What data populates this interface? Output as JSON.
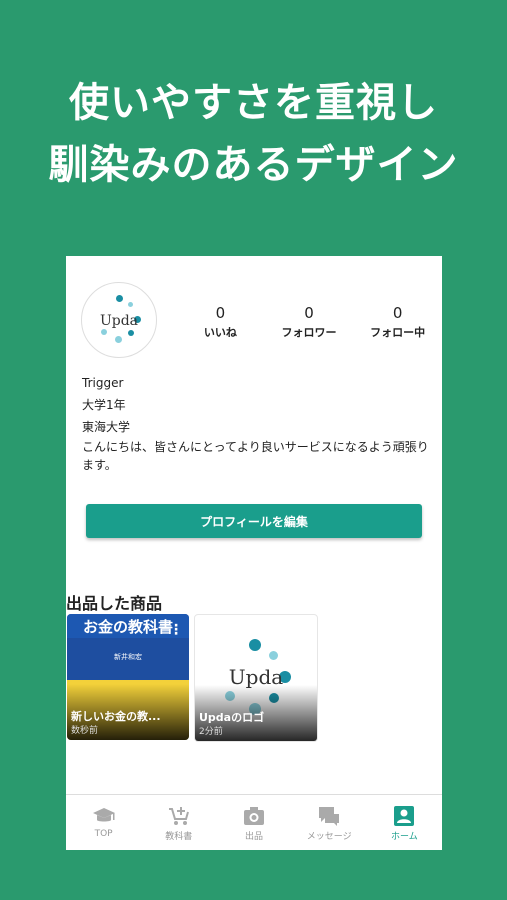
{
  "headline": {
    "line1": "使いやすさを重視し",
    "line2": "馴染みのあるデザイン"
  },
  "profile": {
    "avatar_logo_text": "Upda",
    "stats": [
      {
        "value": "0",
        "label": "いいね"
      },
      {
        "value": "0",
        "label": "フォロワー"
      },
      {
        "value": "0",
        "label": "フォロー中"
      }
    ],
    "name": "Trigger",
    "grade": "大学1年",
    "university": "東海大学",
    "bio": "こんにちは、皆さんにとってより良いサービスになるよう頑張ります。",
    "edit_button_label": "プロフィールを編集"
  },
  "listings": {
    "section_title": "出品した商品",
    "items": [
      {
        "name": "新しいお金の教...",
        "time": "数秒前",
        "cover_title": "お金の教科書",
        "cover_author": "新井和宏"
      },
      {
        "name": "Updaのロゴ",
        "time": "2分前",
        "cover_logo_text": "Upda"
      }
    ]
  },
  "tabbar": {
    "tabs": [
      {
        "label": "TOP",
        "icon": "graduation-cap-icon"
      },
      {
        "label": "教科書",
        "icon": "cart-add-icon"
      },
      {
        "label": "出品",
        "icon": "camera-icon"
      },
      {
        "label": "メッセージ",
        "icon": "chat-icon"
      },
      {
        "label": "ホーム",
        "icon": "user-profile-icon",
        "active": true
      }
    ]
  },
  "colors": {
    "background": "#2a9a6e",
    "accent": "#1a9e8c",
    "inactive_tab": "#999999"
  }
}
